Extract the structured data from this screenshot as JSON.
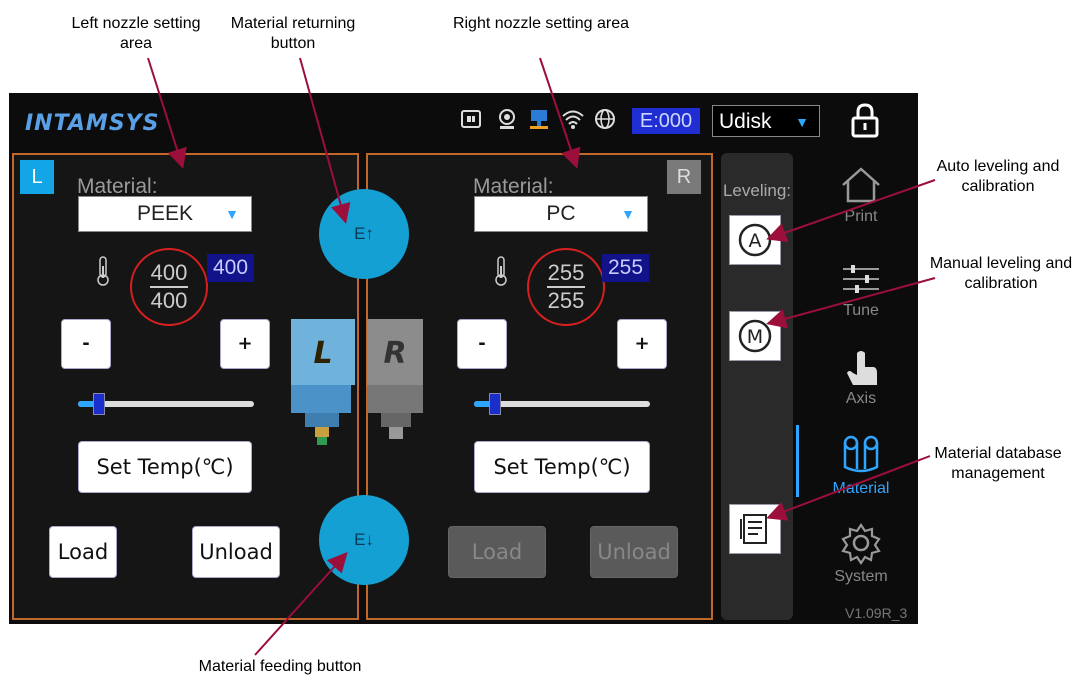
{
  "annotations": {
    "left_nozzle": "Left nozzle setting area",
    "material_returning": "Material returning button",
    "right_nozzle": "Right nozzle setting area",
    "auto_leveling": "Auto leveling and calibration",
    "manual_leveling": "Manual leveling and calibration",
    "material_db": "Material database management",
    "material_feeding": "Material feeding button"
  },
  "header": {
    "logo": "INTAMSYS",
    "e_counter": "E:000",
    "storage_select": "Udisk",
    "icons": [
      "usb-drive-icon",
      "camera-icon",
      "network-icon",
      "wifi-icon",
      "globe-icon",
      "lock-icon"
    ]
  },
  "left": {
    "tag": "L",
    "material_label": "Material:",
    "material": "PEEK",
    "current_temp": "400",
    "target_temp": "400",
    "set_temp_badge": "400",
    "minus": "-",
    "plus": "+",
    "slider_fraction": 0.12,
    "set_temp_button": "Set Temp(℃)",
    "load": "Load",
    "unload": "Unload",
    "nozzle_letter": "L"
  },
  "right": {
    "tag": "R",
    "material_label": "Material:",
    "material": "PC",
    "current_temp": "255",
    "target_temp": "255",
    "set_temp_badge": "255",
    "minus": "-",
    "plus": "+",
    "slider_fraction": 0.12,
    "set_temp_button": "Set Temp(℃)",
    "load": "Load",
    "unload": "Unload",
    "nozzle_letter": "R"
  },
  "round_buttons": {
    "return_label": "E↑",
    "feed_label": "E↓"
  },
  "leveling": {
    "title": "Leveling:",
    "auto": "A",
    "manual": "M"
  },
  "nav": {
    "print": "Print",
    "tune": "Tune",
    "axis": "Axis",
    "material": "Material",
    "system": "System",
    "active": "Material"
  },
  "version": "V1.09R_3",
  "colors": {
    "accent_blue": "#15a0d4",
    "panel_border": "#c0672a",
    "temp_ring": "#d62020",
    "annotation_arrow": "#9b0f3a",
    "left_tag": "#12a6e6",
    "right_tag": "#7a7a7a"
  }
}
